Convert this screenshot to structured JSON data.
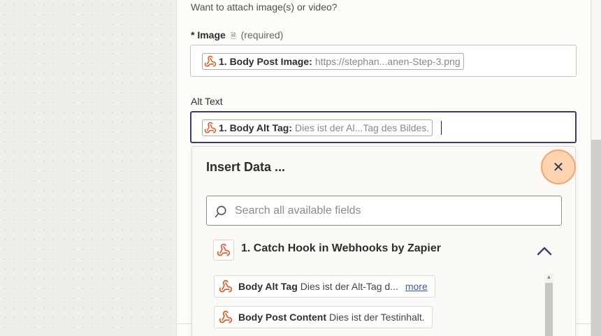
{
  "form": {
    "question": "Want to attach image(s) or video?",
    "image_field": {
      "required_star": "*",
      "label": "Image",
      "required_text": "(required)",
      "pill_title": "1. Body Post Image:",
      "pill_value": "https://stephan...anen-Step-3.png"
    },
    "alt_field": {
      "label": "Alt Text",
      "pill_title": "1. Body Alt Tag:",
      "pill_value": "Dies ist der Al...Tag des Bildes."
    }
  },
  "insert_data": {
    "title": "Insert Data ...",
    "close_glyph": "✕",
    "search_placeholder": "Search all available fields",
    "group": {
      "title": "1. Catch Hook in Webhooks by Zapier"
    },
    "items": [
      {
        "title": "Body Alt Tag",
        "value": "Dies ist der Alt-Tag d...",
        "more": "more"
      },
      {
        "title": "Body Post Content",
        "value": "Dies ist der Testinhalt."
      }
    ]
  },
  "colors": {
    "webhook_icon": "#e8541f",
    "focus_border": "#3a3d75",
    "close_highlight": "#fdd3b0",
    "link": "#3a5ba8"
  },
  "icons": {
    "pill_icon": "webhook-icon",
    "search_icon": "search-icon",
    "chevron": "chevron-up-icon",
    "close": "close-icon",
    "field_hint": "document-icon"
  }
}
